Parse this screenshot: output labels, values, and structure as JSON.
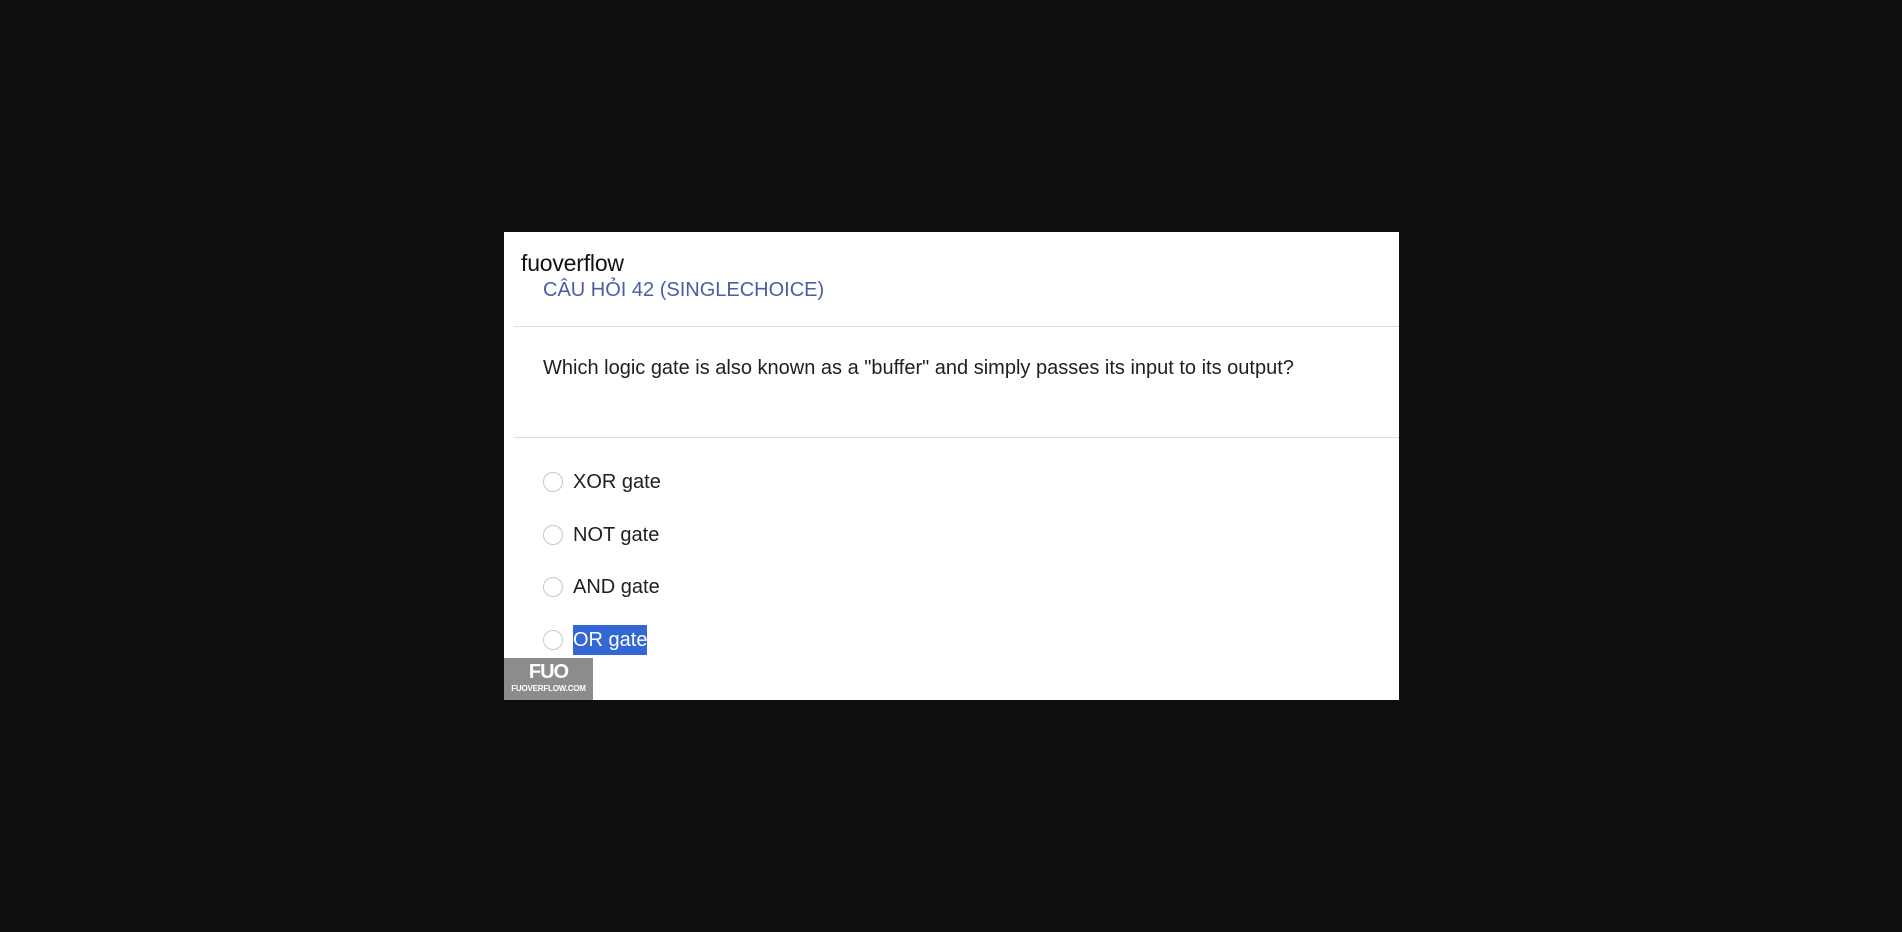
{
  "brand": "fuoverflow",
  "question_title": "CÂU HỎI 42 (SINGLECHOICE)",
  "question_text": "Which logic gate is also known as a \"buffer\" and simply passes its input to its output?",
  "options": [
    {
      "label": "XOR gate",
      "selected": false
    },
    {
      "label": "NOT gate",
      "selected": false
    },
    {
      "label": "AND gate",
      "selected": false
    },
    {
      "label": "OR gate",
      "selected": false,
      "text_highlighted": true
    }
  ],
  "logo": {
    "mark": "FUO",
    "caption": "FUOVERFLOW.COM"
  },
  "colors": {
    "background": "#0f0f0f",
    "card": "#ffffff",
    "title_accent": "#4a5fa3",
    "highlight": "#3367d6",
    "logo_bg": "#8c8c8c"
  }
}
